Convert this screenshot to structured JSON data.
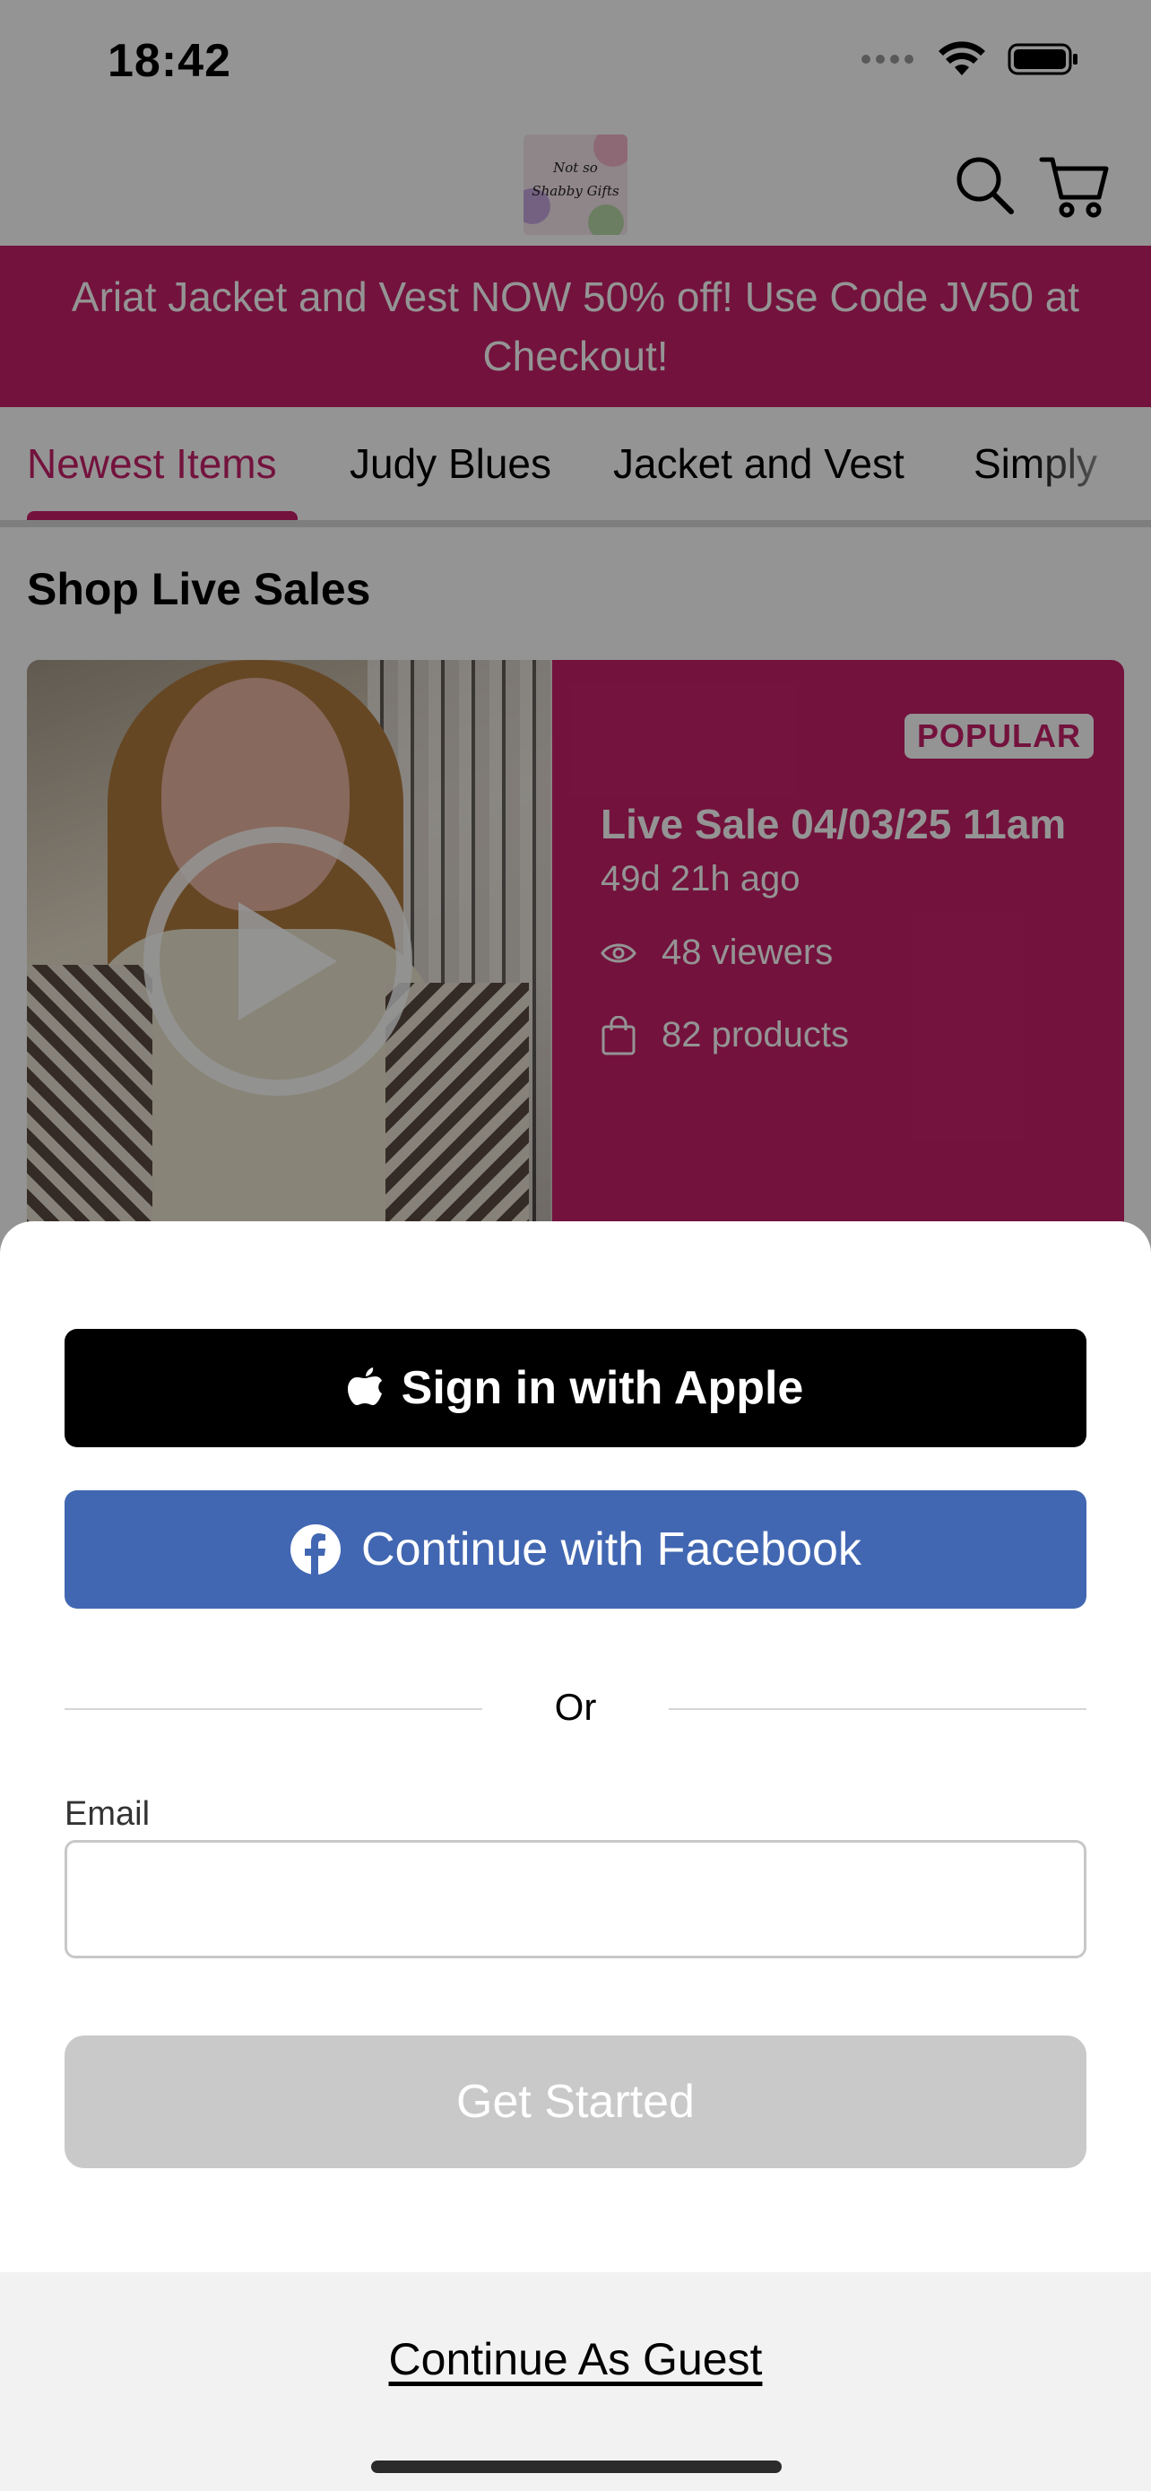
{
  "status_bar": {
    "time": "18:42"
  },
  "header": {
    "logo_lines": [
      "Not so",
      "Shabby Gifts"
    ],
    "icons": [
      "search-icon",
      "cart-icon"
    ]
  },
  "promo_banner": {
    "text": "Ariat Jacket and Vest NOW 50% off! Use Code JV50 at Checkout!"
  },
  "tabs": [
    {
      "label": "Newest Items",
      "active": true
    },
    {
      "label": "Judy Blues",
      "active": false
    },
    {
      "label": "Jacket and Vest",
      "active": false
    },
    {
      "label": "Simply",
      "active": false
    }
  ],
  "live_sales": {
    "section_title": "Shop Live Sales",
    "card": {
      "badge": "POPULAR",
      "title": "Live Sale 04/03/25 11am",
      "ago": "49d 21h ago",
      "viewers": "48 viewers",
      "products": "82 products"
    }
  },
  "sheet": {
    "apple_button": "Sign in with Apple",
    "facebook_button": "Continue with Facebook",
    "divider_text": "Or",
    "email_label": "Email",
    "email_value": "",
    "get_started_button": "Get Started",
    "guest_link": "Continue As Guest"
  },
  "colors": {
    "brand": "#c6206a",
    "facebook": "#4267b2",
    "apple": "#000000",
    "disabled_button": "#c9c9c9"
  }
}
